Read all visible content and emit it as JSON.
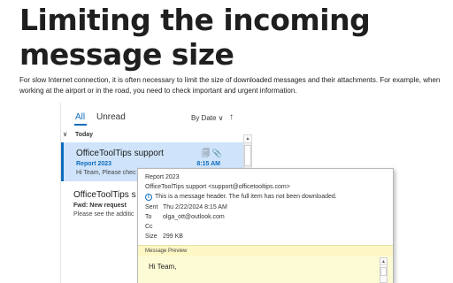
{
  "article": {
    "title_line1": "Limiting the incoming",
    "title_line2": "message size",
    "intro": "For slow Internet connection, it is often necessary to limit the size of downloaded messages and their attachments. For example, when working at the airport or in the road, you need to check important and urgent information."
  },
  "mail_list": {
    "tabs": {
      "all": "All",
      "unread": "Unread"
    },
    "sort_label": "By Date ∨",
    "sort_direction_icon": "↑",
    "group_chevron": "∨",
    "group_label": "Today",
    "messages": [
      {
        "sender": "OfficeToolTips support",
        "subject": "Report 2023",
        "time": "8:15 AM",
        "preview": "Hi Team,   Please chec",
        "icons": "🗐 📎"
      },
      {
        "sender": "OfficeToolTips s",
        "subject": "Fwd: New request",
        "preview": "Please see the additic"
      }
    ]
  },
  "popup": {
    "subject": "Report 2023",
    "from": "OfficeToolTips support <support@officetooltips.com>",
    "info_icon": "i",
    "info_text": "This is a message header. The full item has not been downloaded.",
    "rows": [
      {
        "label": "Sent",
        "value": "Thu 2/22/2024 8:15 AM"
      },
      {
        "label": "To",
        "value": "olga_ott@outlook.com"
      },
      {
        "label": "Cc",
        "value": ""
      },
      {
        "label": "Size",
        "value": "299 KB"
      }
    ],
    "preview_label": "Message Preview",
    "preview_text": "Hi Team,"
  },
  "colors": {
    "accent": "#0f6cbd",
    "selected_bg": "#cfe4fa",
    "preview_bg": "#fdfbd6"
  }
}
